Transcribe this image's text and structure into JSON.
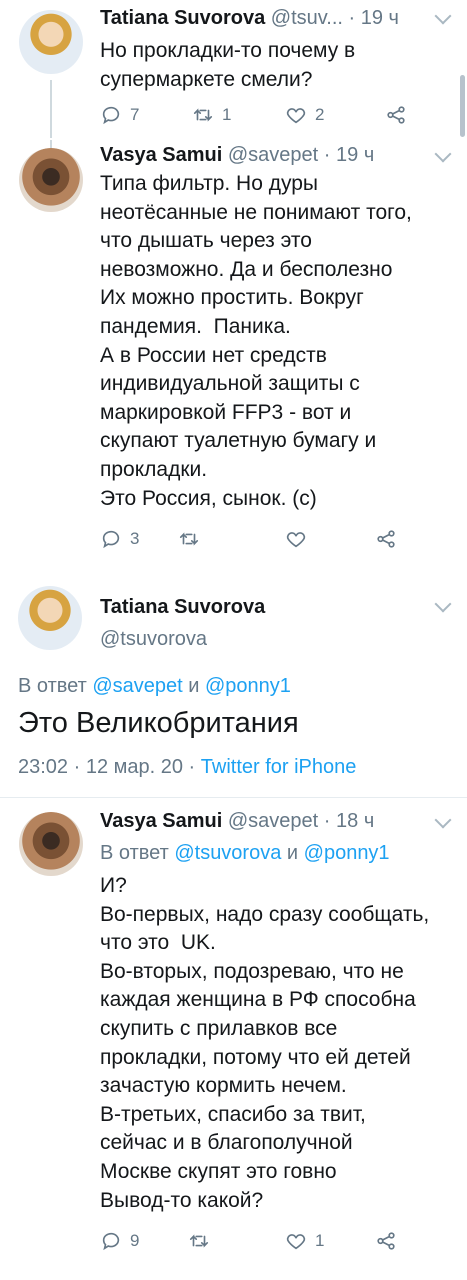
{
  "tweets": [
    {
      "name": "Tatiana Suvorova",
      "handle": "@tsuv...",
      "time": "· 19 ч",
      "text": "Но прокладки-то почему в\nсупермаркете смели?",
      "replies": "7",
      "retweets": "1",
      "likes": "2"
    },
    {
      "name": "Vasya Samui",
      "handle": "@savepet",
      "time": "· 19 ч",
      "text": "Типа фильтр. Но дуры\nнеотёсанные не понимают того,\nчто дышать через это\nневозможно. Да и бесполезно\nИх можно простить. Вокруг\nпандемия.  Паника.\nА в России нет средств\nиндивидуальной защиты с\nмаркировкой FFP3 - вот и\nскупают туалетную бумагу и\nпрокладки.\nЭто Россия, сынок. (с)",
      "replies": "3",
      "retweets": "",
      "likes": ""
    },
    {
      "name": "Vasya Samui",
      "handle": "@savepet",
      "time": "· 18 ч",
      "reply_prefix": "В ответ ",
      "reply_user1": "@tsuvorova",
      "reply_and": " и ",
      "reply_user2": "@ponny1",
      "text": "И?\nВо-первых, надо сразу сообщать,\nчто это  UK.\nВо-вторых, подозреваю, что не\nкаждая женщина в РФ способна\nскупить с прилавков все\nпрокладки, потому что ей детей\nзачастую кормить нечем.\nВ-третьих, спасибо за твит,\nсейчас и в благополучной\nМоскве скупят это говно\nВывод-то какой?",
      "replies": "9",
      "retweets": "",
      "likes": "1"
    }
  ],
  "focused": {
    "name": "Tatiana Suvorova",
    "handle": "@tsuvorova",
    "reply_prefix": "В ответ ",
    "reply_user1": "@savepet",
    "reply_and": " и ",
    "reply_user2": "@ponny1",
    "text": "Это Великобритания",
    "date": "23:02 · 12 мар. 20 · ",
    "source": "Twitter for iPhone"
  },
  "colors": {
    "accent": "#1da1f2",
    "muted": "#657786",
    "text": "#14171a"
  }
}
